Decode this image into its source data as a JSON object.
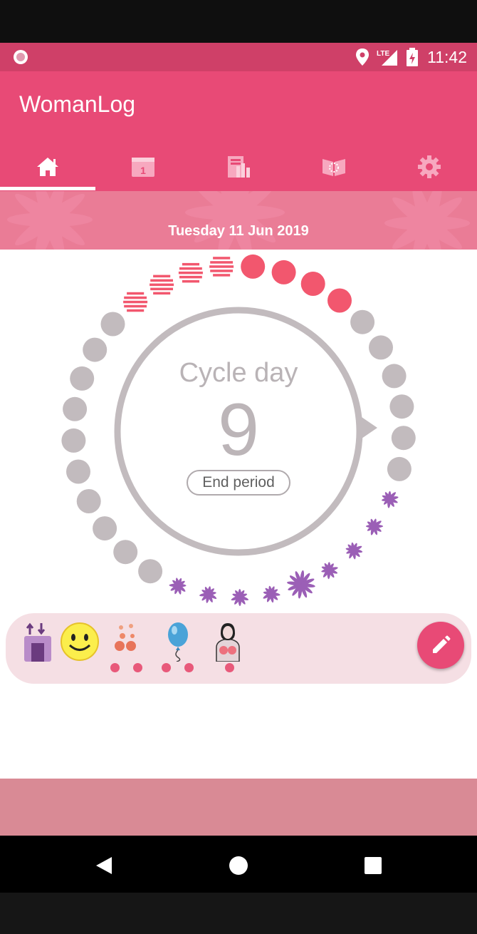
{
  "status_bar": {
    "time": "11:42",
    "network_label": "LTE",
    "icons": [
      "notification-circle-icon",
      "location-icon",
      "signal-icon",
      "battery-icon"
    ]
  },
  "app": {
    "title": "WomanLog",
    "colors": {
      "primary": "#e84a76",
      "status": "#cf4068",
      "period": "#f2576e",
      "fertile": "#9b5fb6",
      "neutral": "#c2bbbe"
    }
  },
  "tabs": [
    {
      "icon": "home-icon",
      "selected": true
    },
    {
      "icon": "calendar-icon",
      "selected": false,
      "badge": "1"
    },
    {
      "icon": "statistics-icon",
      "selected": false
    },
    {
      "icon": "book-icon",
      "selected": false
    },
    {
      "icon": "settings-icon",
      "selected": false
    }
  ],
  "banner": {
    "date": "Tuesday 11 Jun 2019"
  },
  "cycle": {
    "label": "Cycle day",
    "day": "9",
    "end_button": "End period",
    "days": [
      {
        "type": "period"
      },
      {
        "type": "period"
      },
      {
        "type": "period"
      },
      {
        "type": "period"
      },
      {
        "type": "neutral"
      },
      {
        "type": "neutral"
      },
      {
        "type": "neutral"
      },
      {
        "type": "neutral"
      },
      {
        "type": "neutral",
        "current": true
      },
      {
        "type": "neutral"
      },
      {
        "type": "fertile"
      },
      {
        "type": "fertile"
      },
      {
        "type": "fertile"
      },
      {
        "type": "fertile"
      },
      {
        "type": "ovulation"
      },
      {
        "type": "fertile"
      },
      {
        "type": "fertile"
      },
      {
        "type": "fertile"
      },
      {
        "type": "fertile"
      },
      {
        "type": "neutral"
      },
      {
        "type": "neutral"
      },
      {
        "type": "neutral"
      },
      {
        "type": "neutral"
      },
      {
        "type": "neutral"
      },
      {
        "type": "neutral"
      },
      {
        "type": "neutral"
      },
      {
        "type": "neutral"
      },
      {
        "type": "neutral"
      },
      {
        "type": "neutral"
      },
      {
        "type": "predicted"
      },
      {
        "type": "predicted"
      },
      {
        "type": "predicted"
      },
      {
        "type": "predicted"
      }
    ]
  },
  "symptoms": [
    {
      "icon": "weight-scale-icon",
      "dots": 0
    },
    {
      "icon": "smiley-mood-icon",
      "dots": 0
    },
    {
      "icon": "acne-icon",
      "dots": 2
    },
    {
      "icon": "bloating-balloon-icon",
      "dots": 2
    },
    {
      "icon": "breast-tenderness-icon",
      "dots": 1
    }
  ],
  "fab": {
    "icon": "edit-pencil-icon"
  },
  "nav": {
    "icons": [
      "back-icon",
      "home-nav-icon",
      "recents-icon"
    ]
  }
}
